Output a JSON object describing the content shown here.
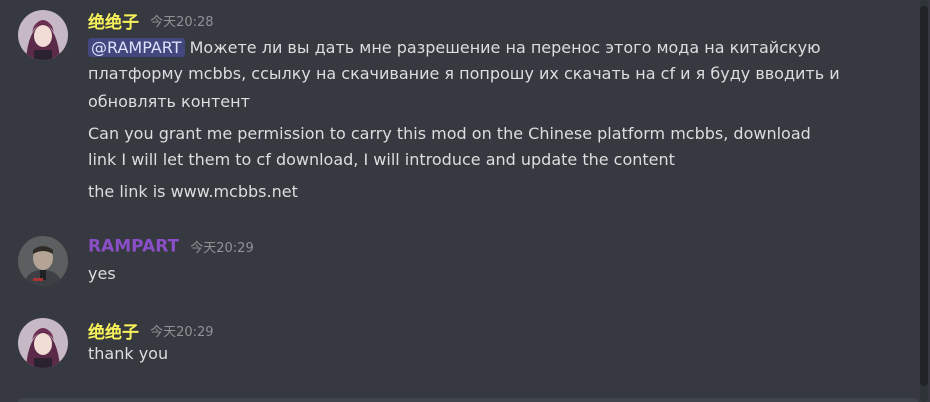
{
  "messages": [
    {
      "author": "绝绝子",
      "author_color": "#f8f25a",
      "timestamp": "今天20:28",
      "lines": {
        "mention": "@RAMPART",
        "ru_text": "Можете ли вы дать мне разрешение на перенос этого мода на китайскую",
        "ru_text_2": "платформу mcbbs, ссылку на скачивание я попрошу их скачать на cf и я буду вводить и",
        "ru_text_3": "обновлять контент",
        "en_text": "Can you grant me permission to carry this mod on the Chinese platform mcbbs, download",
        "en_text_2": "link I will let them to cf download, I will introduce and update the content",
        "link_text": "the link is www.mcbbs.net"
      },
      "avatar_icon": "anime-character-avatar-icon"
    },
    {
      "author": "RAMPART",
      "author_color": "#8a4fc7",
      "timestamp": "今天20:29",
      "lines": {
        "text": "yes"
      },
      "avatar_icon": "uniformed-man-avatar-icon"
    },
    {
      "author": "绝绝子",
      "author_color": "#f8f25a",
      "timestamp": "今天20:29",
      "lines": {
        "text": "thank you"
      },
      "avatar_icon": "anime-character-avatar-icon"
    }
  ],
  "colors": {
    "background": "#36393f",
    "message_text": "#dcddde",
    "timestamp": "#8e9297",
    "mention_bg": "#494f87"
  }
}
